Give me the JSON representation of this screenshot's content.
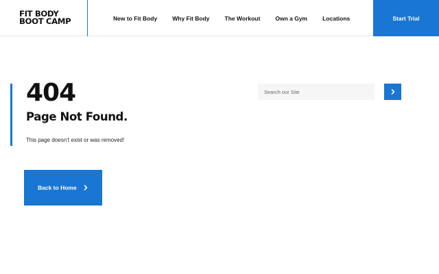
{
  "brand": {
    "logo_line1": "FIT BODY",
    "logo_line2": "BOOT CAMP"
  },
  "nav": {
    "items": [
      {
        "label": "New to Fit Body"
      },
      {
        "label": "Why Fit Body"
      },
      {
        "label": "The Workout"
      },
      {
        "label": "Own a Gym"
      },
      {
        "label": "Locations"
      }
    ],
    "cta_label": "Start Trial"
  },
  "error": {
    "code": "404",
    "title": "Page Not Found.",
    "message": "This page doesn’t exist or was removed!"
  },
  "back_button": {
    "label": "Back to Home",
    "icon": "chevron-right-icon"
  },
  "search": {
    "placeholder": "Search our Site",
    "value": "",
    "submit_icon": "chevron-right-icon"
  },
  "colors": {
    "accent": "#1976d2",
    "text": "#111111",
    "search_bg": "#f6f6f6"
  }
}
